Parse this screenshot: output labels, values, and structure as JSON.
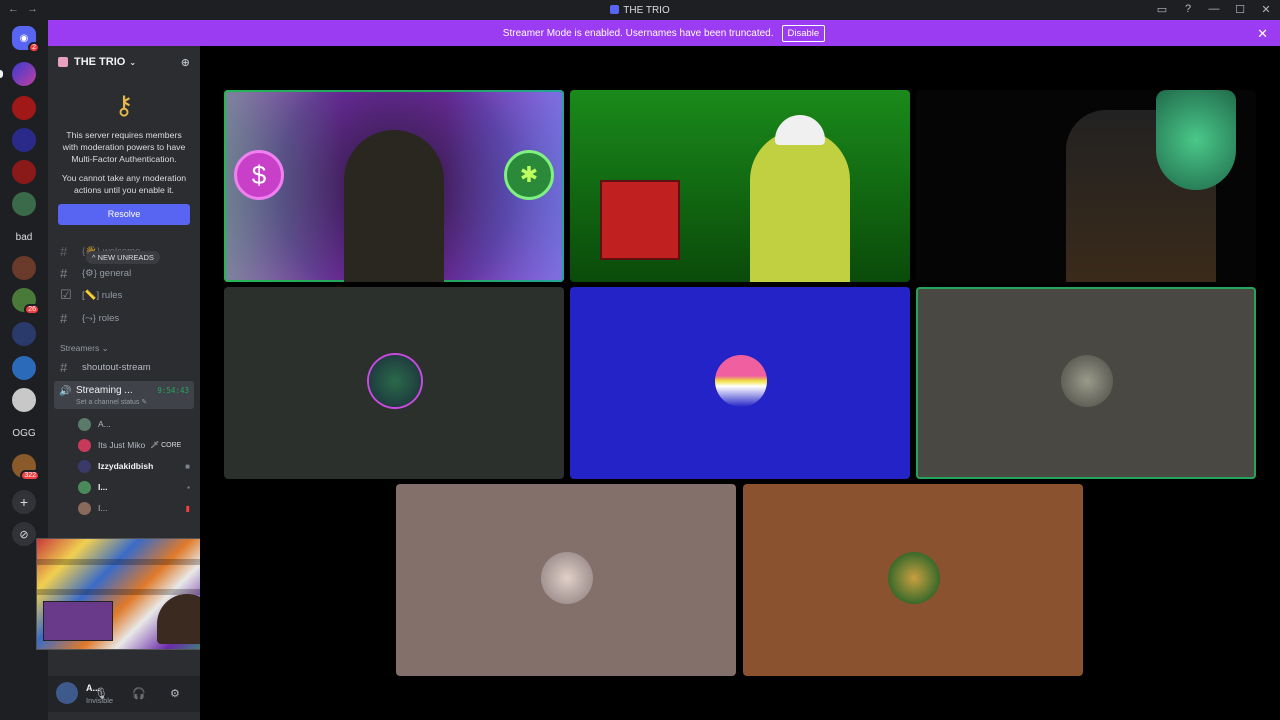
{
  "titlebar": {
    "app_title": "THE TRIO",
    "nav_back": "←",
    "nav_forward": "→",
    "controls": [
      "▭",
      "?",
      "—",
      "☐",
      "✕"
    ]
  },
  "banner": {
    "message": "Streamer Mode is enabled. Usernames have been truncated.",
    "disable_label": "Disable",
    "close": "✕",
    "color": "#9b3bf2"
  },
  "guilds": {
    "home_badge": "2",
    "bad_label": "bad",
    "ogg_label": "OGG",
    "badge_26": "26",
    "badge_322": "322",
    "add": "+",
    "discover": "⊘"
  },
  "server": {
    "name": "THE TRIO",
    "chevron": "⌄",
    "add_member": "⊕"
  },
  "mfa": {
    "line1": "This server requires members with moderation powers to have Multi-Factor Authentication.",
    "line2": "You cannot take any moderation actions until you enable it.",
    "resolve_label": "Resolve"
  },
  "channels": {
    "new_unreads": "^ NEW UNREADS",
    "general": "{⚙} general",
    "rules": "[📏] rules",
    "roles": "{⤳} roles",
    "welcome": "{👋} welcome",
    "category_streamers": "Streamers ⌄",
    "shoutout": "shoutout-stream",
    "voice_name": "Streaming ...",
    "voice_time": "9:54:43",
    "voice_status": "Set a channel status ✎"
  },
  "members": [
    {
      "name": "A...",
      "tag": "",
      "color": "#5a7a6a"
    },
    {
      "name": "Its Just Miko",
      "tag": "🗡 CORE",
      "color": "#c83a5a"
    },
    {
      "name": "Izzydakidbish",
      "tag": "",
      "color": "#3a3a6a"
    },
    {
      "name": "I...",
      "tag": "",
      "color": "#4a8a5a"
    },
    {
      "name": "I...",
      "tag": "",
      "color": "#8a6a5a"
    }
  ],
  "user": {
    "name": "A...",
    "status": "Invisible",
    "mic": "🎙",
    "headset": "🎧",
    "settings": "⚙"
  },
  "colors": {
    "speaking": "#23a55a",
    "accent": "#5865f2",
    "tile_blue": "#2323c8",
    "tile_dark": "#2b302d",
    "tile_gray": "#4a4843",
    "tile_rose": "#84706a",
    "tile_brown": "#8a522f"
  }
}
